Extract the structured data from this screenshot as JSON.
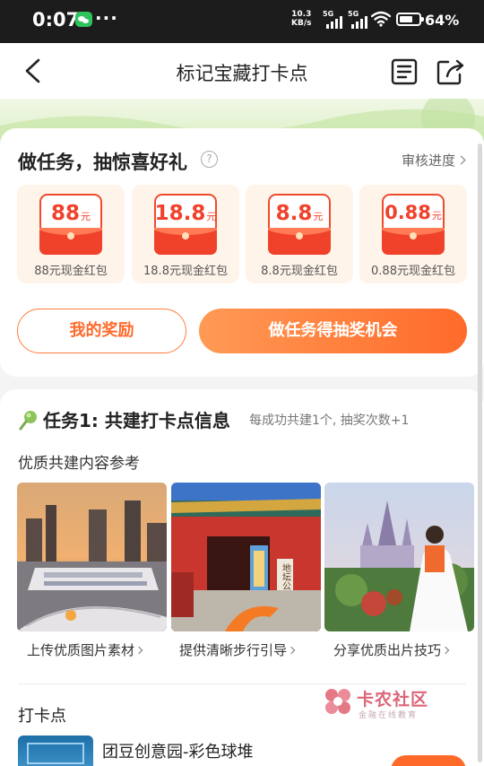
{
  "status_bar": {
    "time": "0:07",
    "net_speed_value": "10.3",
    "net_speed_unit": "KB/s",
    "signal1_label": "5G",
    "signal2_label": "5G",
    "battery": "64%",
    "more": "···"
  },
  "nav": {
    "title": "标记宝藏打卡点"
  },
  "reward_card": {
    "title": "做任务，抽惊喜好礼",
    "help": "?",
    "review_link": "审核进度",
    "prizes": [
      {
        "amount": "88",
        "unit": "元",
        "label": "88元现金红包"
      },
      {
        "amount": "18.8",
        "unit": "元",
        "label": "18.8元现金红包"
      },
      {
        "amount": "8.8",
        "unit": "元",
        "label": "8.8元现金红包"
      },
      {
        "amount": "0.88",
        "unit": "元",
        "label": "0.88元现金红包"
      }
    ],
    "my_rewards_button": "我的奖励",
    "task_button": "做任务得抽奖机会"
  },
  "task_card": {
    "title": "任务1: 共建打卡点信息",
    "note": "每成功共建1个, 抽奖次数+1",
    "reference_title": "优质共建内容参考",
    "references": [
      {
        "caption": "上传优质图片素材"
      },
      {
        "caption": "提供清晰步行引导"
      },
      {
        "caption": "分享优质出片技巧"
      }
    ],
    "gate_sign": "地坛公园",
    "checkin_title": "打卡点",
    "spot_name": "团豆创意园-彩色球堆"
  },
  "watermark": {
    "name": "卡农社区",
    "sub": "金融在线教育"
  },
  "colors": {
    "accent": "#ff6a2a",
    "red": "#f0412b",
    "banner": "#dcefc4"
  }
}
